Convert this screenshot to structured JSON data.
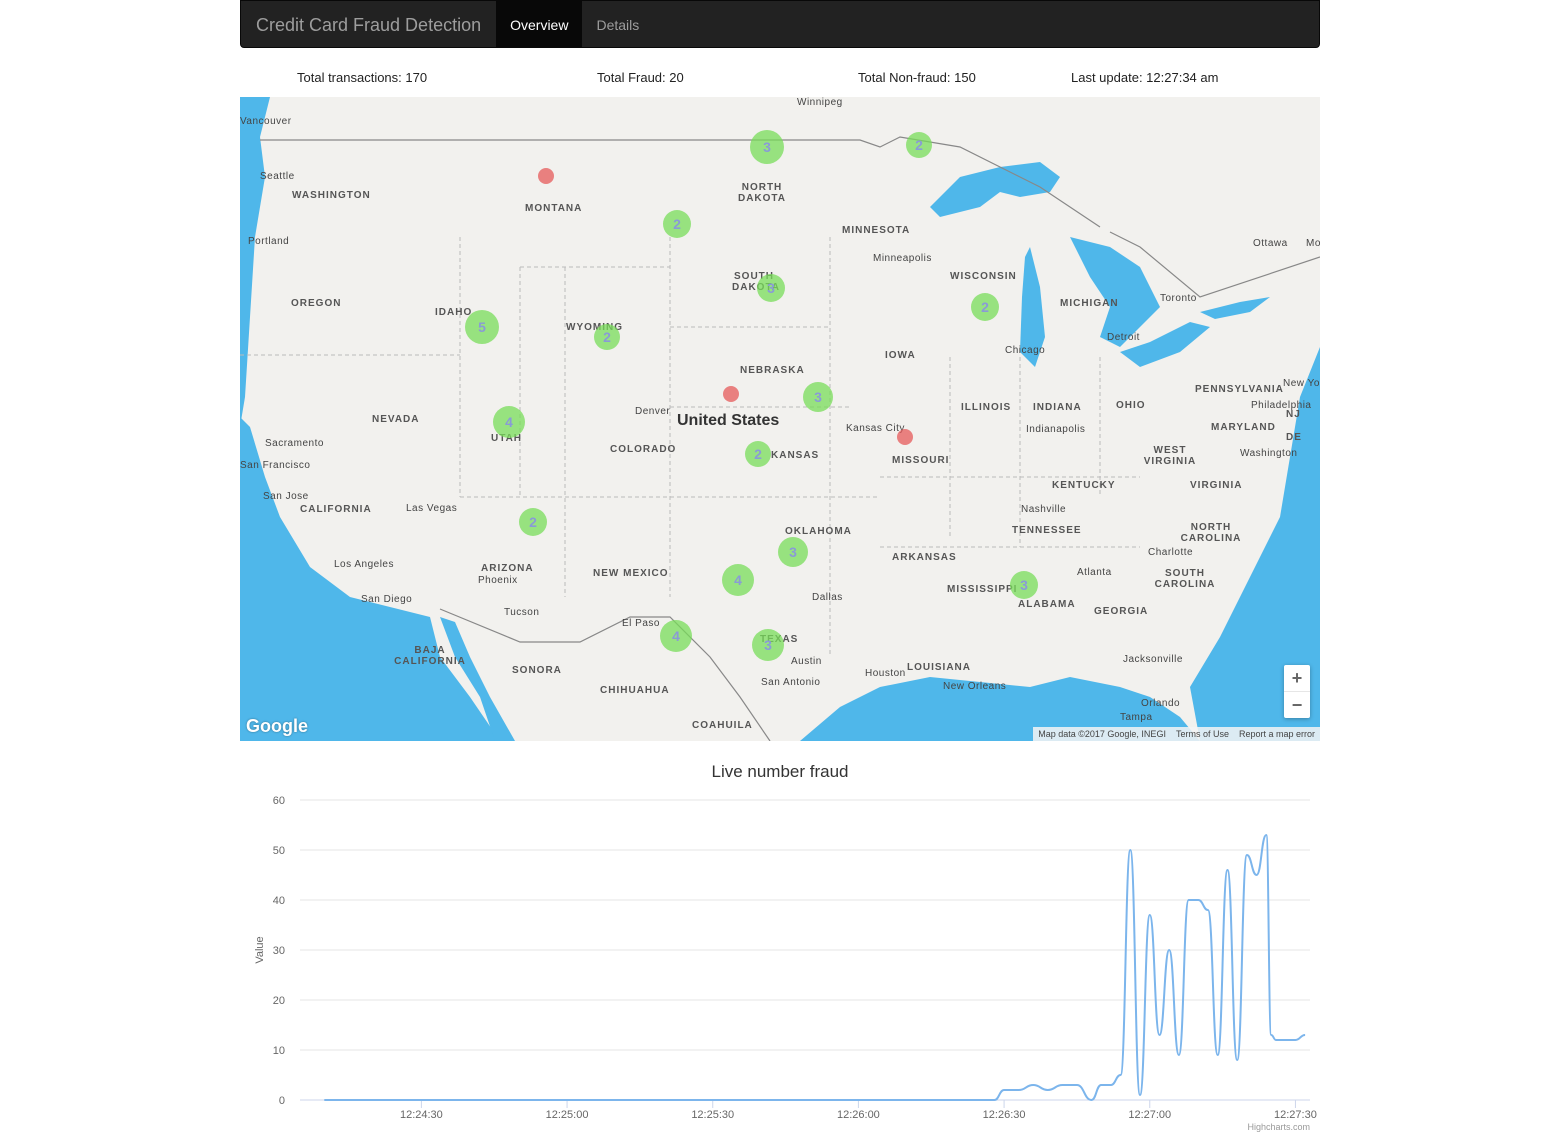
{
  "navbar": {
    "brand": "Credit Card Fraud Detection",
    "tabs": [
      {
        "label": "Overview",
        "active": true
      },
      {
        "label": "Details",
        "active": false
      }
    ]
  },
  "stats": {
    "total_transactions": "Total transactions: 170",
    "total_fraud": "Total Fraud: 20",
    "total_nonfraud": "Total Non-fraud: 150",
    "last_update": "Last update: 12:27:34 am"
  },
  "map": {
    "country_label": "United States",
    "state_labels": [
      "WASHINGTON",
      "MONTANA",
      "NORTH DAKOTA",
      "MINNESOTA",
      "OREGON",
      "IDAHO",
      "WYOMING",
      "SOUTH DAKOTA",
      "WISCONSIN",
      "MICHIGAN",
      "NEVADA",
      "UTAH",
      "COLORADO",
      "NEBRASKA",
      "IOWA",
      "ILLINOIS",
      "INDIANA",
      "OHIO",
      "PENNSYLVANIA",
      "CALIFORNIA",
      "KANSAS",
      "MISSOURI",
      "KENTUCKY",
      "WEST VIRGINIA",
      "VIRGINIA",
      "MARYLAND",
      "NJ",
      "DE",
      "ARIZONA",
      "NEW MEXICO",
      "OKLAHOMA",
      "ARKANSAS",
      "TENNESSEE",
      "NORTH CAROLINA",
      "SOUTH CAROLINA",
      "MISSISSIPPI",
      "ALABAMA",
      "GEORGIA",
      "TEXAS",
      "LOUISIANA",
      "SONORA",
      "CHIHUAHUA",
      "COAHUILA",
      "BAJA CALIFORNIA"
    ],
    "city_labels": [
      "Vancouver",
      "Seattle",
      "Portland",
      "Winnipeg",
      "Minneapolis",
      "Ottawa",
      "Mo",
      "Toronto",
      "Detroit",
      "Chicago",
      "New York",
      "Philadelphia",
      "Washington",
      "Sacramento",
      "San Francisco",
      "San Jose",
      "Las Vegas",
      "Los Angeles",
      "San Diego",
      "Phoenix",
      "Tucson",
      "Denver",
      "Kansas City",
      "Indianapolis",
      "Nashville",
      "Charlotte",
      "Atlanta",
      "El Paso",
      "Dallas",
      "Austin",
      "San Antonio",
      "Houston",
      "New Orleans",
      "Jacksonville",
      "Orlando",
      "Tampa"
    ],
    "clusters": [
      {
        "type": "ok",
        "count": "3"
      },
      {
        "type": "ok",
        "count": "2"
      },
      {
        "type": "ok",
        "count": "5"
      },
      {
        "type": "ok",
        "count": "2"
      },
      {
        "type": "ok",
        "count": "4"
      },
      {
        "type": "ok",
        "count": "3"
      },
      {
        "type": "ok",
        "count": "2"
      },
      {
        "type": "ok",
        "count": "3"
      },
      {
        "type": "ok",
        "count": "2"
      },
      {
        "type": "ok",
        "count": "4"
      },
      {
        "type": "ok",
        "count": "3"
      },
      {
        "type": "ok",
        "count": "4"
      },
      {
        "type": "ok",
        "count": "3"
      },
      {
        "type": "ok",
        "count": "2"
      },
      {
        "type": "ok",
        "count": "2"
      },
      {
        "type": "ok",
        "count": "3"
      },
      {
        "type": "fraud",
        "count": ""
      },
      {
        "type": "fraud",
        "count": ""
      },
      {
        "type": "fraud",
        "count": ""
      }
    ],
    "zoom_in": "+",
    "zoom_out": "−",
    "google": "Google",
    "footer": [
      "Map data ©2017 Google, INEGI",
      "Terms of Use",
      "Report a map error"
    ]
  },
  "chart_data": {
    "type": "line",
    "title": "Live number fraud",
    "ylabel": "Value",
    "ylim": [
      0,
      60
    ],
    "yticks": [
      0,
      10,
      20,
      30,
      40,
      50,
      60
    ],
    "xticks": [
      "12:24:30",
      "12:25:00",
      "12:25:30",
      "12:26:00",
      "12:26:30",
      "12:27:00",
      "12:27:30"
    ],
    "series": [
      {
        "color": "#7cb5ec",
        "x": [
          "12:24:10",
          "12:24:30",
          "12:25:00",
          "12:25:30",
          "12:26:00",
          "12:26:20",
          "12:26:28",
          "12:26:30",
          "12:26:33",
          "12:26:36",
          "12:26:39",
          "12:26:42",
          "12:26:45",
          "12:26:48",
          "12:26:50",
          "12:26:52",
          "12:26:54",
          "12:26:56",
          "12:26:58",
          "12:27:00",
          "12:27:02",
          "12:27:04",
          "12:27:06",
          "12:27:08",
          "12:27:10",
          "12:27:12",
          "12:27:14",
          "12:27:16",
          "12:27:18",
          "12:27:20",
          "12:27:22",
          "12:27:24",
          "12:27:25",
          "12:27:26",
          "12:27:27",
          "12:27:28",
          "12:27:30",
          "12:27:32"
        ],
        "values": [
          0,
          0,
          0,
          0,
          0,
          0,
          0,
          2,
          2,
          3,
          2,
          3,
          3,
          0,
          3,
          3,
          5,
          50,
          1,
          37,
          13,
          30,
          9,
          40,
          40,
          38,
          9,
          46,
          8,
          49,
          45,
          53,
          13,
          12,
          12,
          12,
          12,
          13
        ]
      }
    ]
  },
  "credits": "Highcharts.com"
}
